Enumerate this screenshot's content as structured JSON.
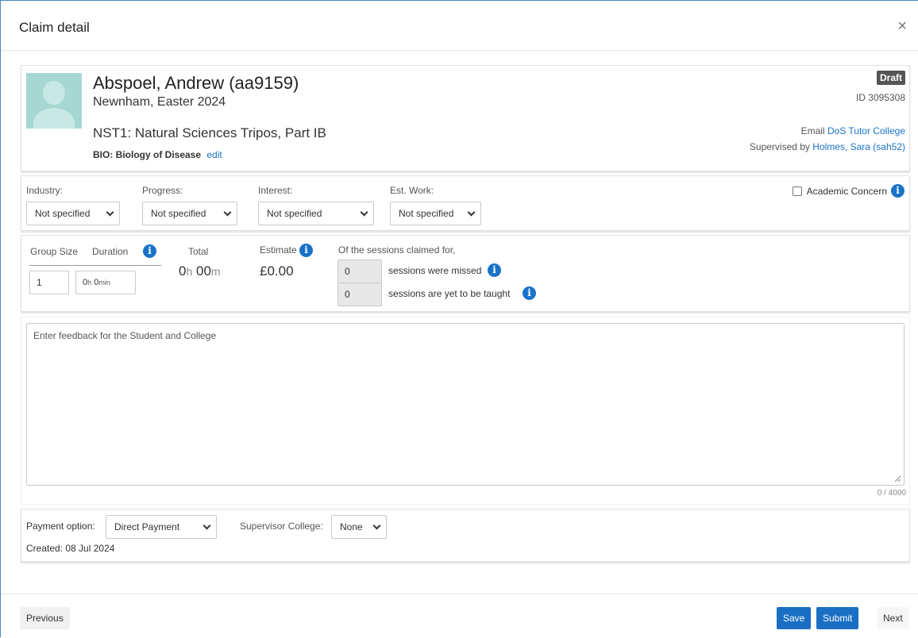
{
  "modal": {
    "title": "Claim detail",
    "close_glyph": "×"
  },
  "student": {
    "name": "Abspoel, Andrew (aa9159)",
    "college_term": "Newnham, Easter 2024",
    "course": "NST1: Natural Sciences Tripos, Part IB",
    "paper": "BIO: Biology of Disease",
    "edit_label": "edit",
    "status": "Draft",
    "claim_id": "ID 3095308",
    "email_prefix": "Email",
    "email_link": "DoS Tutor College",
    "supervised_prefix": "Supervised by",
    "supervisor_link": "Holmes, Sara (sah52)"
  },
  "assessment": {
    "industry": {
      "label": "Industry:",
      "value": "Not specified"
    },
    "progress": {
      "label": "Progress:",
      "value": "Not specified"
    },
    "interest": {
      "label": "Interest:",
      "value": "Not specified"
    },
    "est_work": {
      "label": "Est. Work:",
      "value": "Not specified"
    },
    "academic_concern": {
      "label": "Academic Concern",
      "checked": false
    }
  },
  "sessions": {
    "group_size_label": "Group Size",
    "duration_label": "Duration",
    "group_size_value": "1",
    "duration_h": "0",
    "duration_h_unit": "h",
    "duration_m": "0",
    "duration_m_unit": "min",
    "total_label": "Total",
    "total_h": "0",
    "total_h_unit": "h",
    "total_m": "00",
    "total_m_unit": "m",
    "estimate_label": "Estimate",
    "estimate_value": "£0.00",
    "claimed_intro": "Of the sessions claimed for,",
    "missed_value": "0",
    "missed_text": "sessions were missed",
    "yet_value": "0",
    "yet_text": "sessions are yet to be taught"
  },
  "feedback": {
    "placeholder": "Enter feedback for the Student and College",
    "counter": "0 / 4000"
  },
  "payment": {
    "option_label": "Payment option:",
    "option_value": "Direct Payment",
    "college_label": "Supervisor College:",
    "college_value": "None",
    "created": "Created: 08 Jul 2024"
  },
  "footer": {
    "previous": "Previous",
    "save": "Save",
    "submit": "Submit",
    "next": "Next"
  },
  "icons": {
    "info": "i"
  },
  "colors": {
    "primary": "#1a6fc4",
    "link": "#1a73c8",
    "draft_badge": "#555555"
  }
}
